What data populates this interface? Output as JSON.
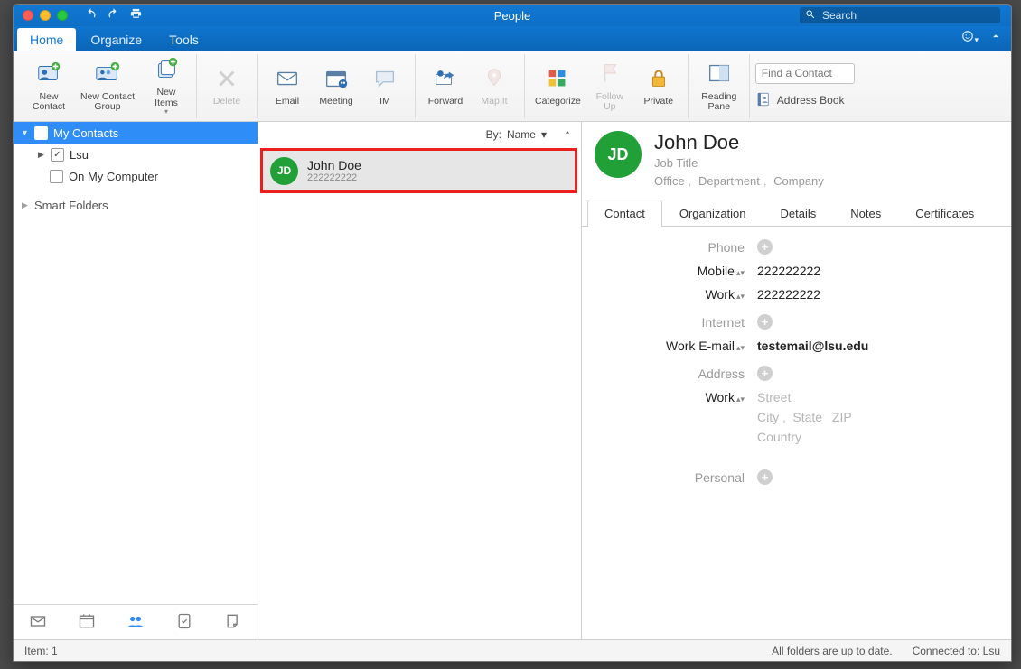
{
  "window": {
    "title": "People"
  },
  "search": {
    "placeholder": "Search"
  },
  "tabs": {
    "home": "Home",
    "organize": "Organize",
    "tools": "Tools"
  },
  "ribbon": {
    "new_contact": "New\nContact",
    "new_contact_group": "New Contact\nGroup",
    "new_items": "New\nItems",
    "delete": "Delete",
    "email": "Email",
    "meeting": "Meeting",
    "im": "IM",
    "forward": "Forward",
    "map_it": "Map It",
    "categorize": "Categorize",
    "follow_up": "Follow\nUp",
    "private": "Private",
    "reading_pane": "Reading\nPane",
    "find_contact_ph": "Find a Contact",
    "address_book": "Address Book"
  },
  "sidebar": {
    "my_contacts": "My Contacts",
    "lsu": "Lsu",
    "on_my_computer": "On My Computer",
    "smart_folders": "Smart Folders"
  },
  "list": {
    "sortby_label": "By:",
    "sortby_value": "Name",
    "items": [
      {
        "initials": "JD",
        "name": "John Doe",
        "sub": "222222222"
      }
    ]
  },
  "detail": {
    "initials": "JD",
    "name": "John Doe",
    "job_title_ph": "Job Title",
    "office_ph": "Office",
    "department_ph": "Department",
    "company_ph": "Company",
    "tabs": {
      "contact": "Contact",
      "organization": "Organization",
      "details": "Details",
      "notes": "Notes",
      "certificates": "Certificates"
    },
    "sections": {
      "phone": "Phone",
      "internet": "Internet",
      "address": "Address",
      "personal": "Personal"
    },
    "fields": {
      "mobile_label": "Mobile",
      "mobile_value": "222222222",
      "work_phone_label": "Work",
      "work_phone_value": "222222222",
      "work_email_label": "Work E-mail",
      "work_email_value": "testemail@lsu.edu",
      "work_addr_label": "Work",
      "street_ph": "Street",
      "city_ph": "City",
      "state_ph": "State",
      "zip_ph": "ZIP",
      "country_ph": "Country"
    }
  },
  "status": {
    "item_count": "Item: 1",
    "folders": "All folders are up to date.",
    "connected": "Connected to: Lsu"
  }
}
